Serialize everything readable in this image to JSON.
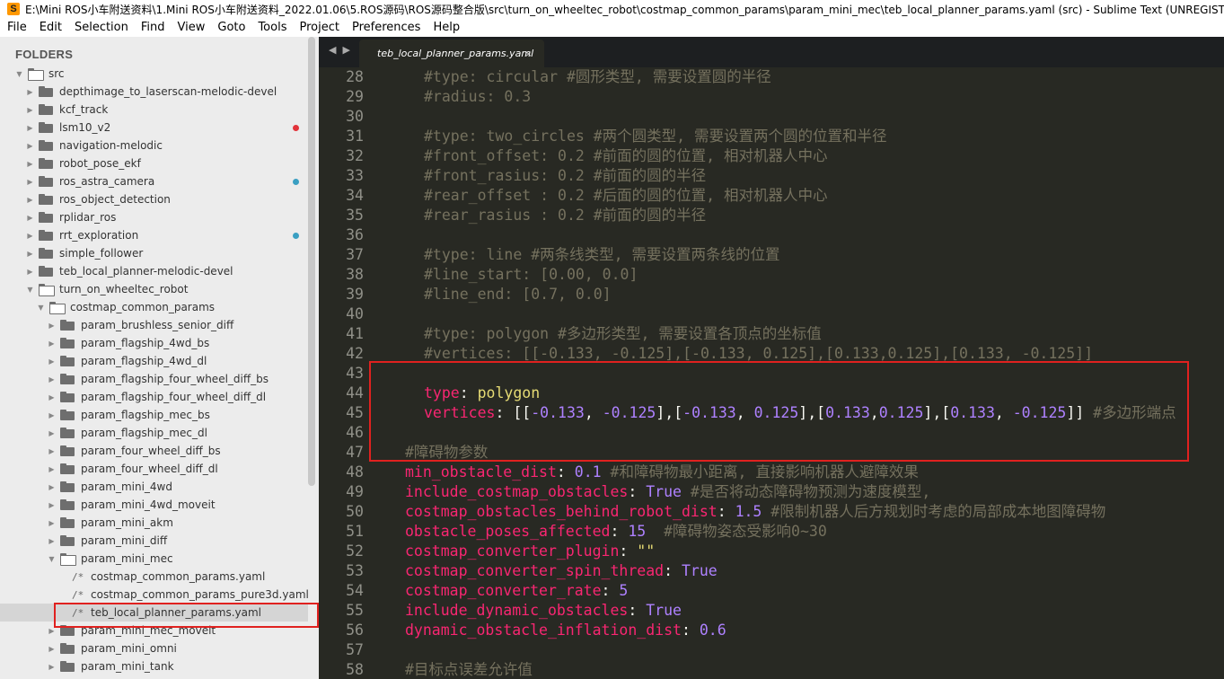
{
  "window": {
    "title": "E:\\Mini ROS小车附送资料\\1.Mini ROS小车附送资料_2022.01.06\\5.ROS源码\\ROS源码整合版\\src\\turn_on_wheeltec_robot\\costmap_common_params\\param_mini_mec\\teb_local_planner_params.yaml (src) - Sublime Text (UNREGISTERED)",
    "app_icon": "S"
  },
  "menu": [
    "File",
    "Edit",
    "Selection",
    "Find",
    "View",
    "Goto",
    "Tools",
    "Project",
    "Preferences",
    "Help"
  ],
  "sidebar": {
    "header": "FOLDERS",
    "items": [
      {
        "label": "src",
        "type": "folder",
        "open": true,
        "depth": 0
      },
      {
        "label": "depthimage_to_laserscan-melodic-devel",
        "type": "folder",
        "depth": 1
      },
      {
        "label": "kcf_track",
        "type": "folder",
        "depth": 1
      },
      {
        "label": "lsm10_v2",
        "type": "folder",
        "depth": 1,
        "status": "red"
      },
      {
        "label": "navigation-melodic",
        "type": "folder",
        "depth": 1
      },
      {
        "label": "robot_pose_ekf",
        "type": "folder",
        "depth": 1
      },
      {
        "label": "ros_astra_camera",
        "type": "folder",
        "depth": 1,
        "status": "teal"
      },
      {
        "label": "ros_object_detection",
        "type": "folder",
        "depth": 1
      },
      {
        "label": "rplidar_ros",
        "type": "folder",
        "depth": 1
      },
      {
        "label": "rrt_exploration",
        "type": "folder",
        "depth": 1,
        "status": "teal"
      },
      {
        "label": "simple_follower",
        "type": "folder",
        "depth": 1
      },
      {
        "label": "teb_local_planner-melodic-devel",
        "type": "folder",
        "depth": 1
      },
      {
        "label": "turn_on_wheeltec_robot",
        "type": "folder",
        "open": true,
        "depth": 1
      },
      {
        "label": "costmap_common_params",
        "type": "folder",
        "open": true,
        "depth": 2
      },
      {
        "label": "param_brushless_senior_diff",
        "type": "folder",
        "depth": 3
      },
      {
        "label": "param_flagship_4wd_bs",
        "type": "folder",
        "depth": 3
      },
      {
        "label": "param_flagship_4wd_dl",
        "type": "folder",
        "depth": 3
      },
      {
        "label": "param_flagship_four_wheel_diff_bs",
        "type": "folder",
        "depth": 3
      },
      {
        "label": "param_flagship_four_wheel_diff_dl",
        "type": "folder",
        "depth": 3
      },
      {
        "label": "param_flagship_mec_bs",
        "type": "folder",
        "depth": 3
      },
      {
        "label": "param_flagship_mec_dl",
        "type": "folder",
        "depth": 3
      },
      {
        "label": "param_four_wheel_diff_bs",
        "type": "folder",
        "depth": 3
      },
      {
        "label": "param_four_wheel_diff_dl",
        "type": "folder",
        "depth": 3
      },
      {
        "label": "param_mini_4wd",
        "type": "folder",
        "depth": 3
      },
      {
        "label": "param_mini_4wd_moveit",
        "type": "folder",
        "depth": 3
      },
      {
        "label": "param_mini_akm",
        "type": "folder",
        "depth": 3
      },
      {
        "label": "param_mini_diff",
        "type": "folder",
        "depth": 3
      },
      {
        "label": "param_mini_mec",
        "type": "folder",
        "open": true,
        "depth": 3
      },
      {
        "label": "costmap_common_params.yaml",
        "type": "file",
        "depth": 4
      },
      {
        "label": "costmap_common_params_pure3d.yaml",
        "type": "file",
        "depth": 4
      },
      {
        "label": "teb_local_planner_params.yaml",
        "type": "file",
        "depth": 4,
        "selected": true
      },
      {
        "label": "param_mini_mec_moveit",
        "type": "folder",
        "depth": 3
      },
      {
        "label": "param_mini_omni",
        "type": "folder",
        "depth": 3
      },
      {
        "label": "param_mini_tank",
        "type": "folder",
        "depth": 3
      }
    ]
  },
  "tabs": {
    "nav": "◀ ▶",
    "active": "teb_local_planner_params.yaml",
    "close": "×"
  },
  "editor": {
    "lines": [
      {
        "n": "28",
        "indent": 2,
        "parts": [
          {
            "t": "#type: circular #圆形类型, 需要设置圆的半径",
            "c": "cm"
          }
        ]
      },
      {
        "n": "29",
        "indent": 2,
        "parts": [
          {
            "t": "#radius: 0.3",
            "c": "cm"
          }
        ]
      },
      {
        "n": "30",
        "indent": 2,
        "parts": []
      },
      {
        "n": "31",
        "indent": 2,
        "parts": [
          {
            "t": "#type: two_circles #两个圆类型, 需要设置两个圆的位置和半径",
            "c": "cm"
          }
        ]
      },
      {
        "n": "32",
        "indent": 2,
        "parts": [
          {
            "t": "#front_offset: 0.2 #前面的圆的位置, 相对机器人中心",
            "c": "cm"
          }
        ]
      },
      {
        "n": "33",
        "indent": 2,
        "parts": [
          {
            "t": "#front_rasius: 0.2 #前面的圆的半径",
            "c": "cm"
          }
        ]
      },
      {
        "n": "34",
        "indent": 2,
        "parts": [
          {
            "t": "#rear_offset : 0.2 #后面的圆的位置, 相对机器人中心",
            "c": "cm"
          }
        ]
      },
      {
        "n": "35",
        "indent": 2,
        "parts": [
          {
            "t": "#rear_rasius : 0.2 #前面的圆的半径",
            "c": "cm"
          }
        ]
      },
      {
        "n": "36",
        "indent": 2,
        "parts": []
      },
      {
        "n": "37",
        "indent": 2,
        "parts": [
          {
            "t": "#type: line #两条线类型, 需要设置两条线的位置",
            "c": "cm"
          }
        ]
      },
      {
        "n": "38",
        "indent": 2,
        "parts": [
          {
            "t": "#line_start: [0.00, 0.0]",
            "c": "cm"
          }
        ]
      },
      {
        "n": "39",
        "indent": 2,
        "parts": [
          {
            "t": "#line_end: [0.7, 0.0]",
            "c": "cm"
          }
        ]
      },
      {
        "n": "40",
        "indent": 2,
        "parts": []
      },
      {
        "n": "41",
        "indent": 2,
        "parts": [
          {
            "t": "#type: polygon #多边形类型, 需要设置各顶点的坐标值",
            "c": "cm"
          }
        ]
      },
      {
        "n": "42",
        "indent": 2,
        "parts": [
          {
            "t": "#vertices: [[-0.133, -0.125],[-0.133, 0.125],[0.133,0.125],[0.133, -0.125]]",
            "c": "cm"
          }
        ]
      },
      {
        "n": "43",
        "indent": 2,
        "parts": []
      },
      {
        "n": "44",
        "indent": 2,
        "parts": [
          {
            "t": "type",
            "c": "k"
          },
          {
            "t": ": ",
            "c": "p"
          },
          {
            "t": "polygon",
            "c": "v"
          }
        ]
      },
      {
        "n": "45",
        "indent": 2,
        "parts": [
          {
            "t": "vertices",
            "c": "k"
          },
          {
            "t": ": [[",
            "c": "p"
          },
          {
            "t": "-0.133",
            "c": "n"
          },
          {
            "t": ", ",
            "c": "p"
          },
          {
            "t": "-0.125",
            "c": "n"
          },
          {
            "t": "],[",
            "c": "p"
          },
          {
            "t": "-0.133",
            "c": "n"
          },
          {
            "t": ", ",
            "c": "p"
          },
          {
            "t": "0.125",
            "c": "n"
          },
          {
            "t": "],[",
            "c": "p"
          },
          {
            "t": "0.133",
            "c": "n"
          },
          {
            "t": ",",
            "c": "p"
          },
          {
            "t": "0.125",
            "c": "n"
          },
          {
            "t": "],[",
            "c": "p"
          },
          {
            "t": "0.133",
            "c": "n"
          },
          {
            "t": ", ",
            "c": "p"
          },
          {
            "t": "-0.125",
            "c": "n"
          },
          {
            "t": "]] ",
            "c": "p"
          },
          {
            "t": "#多边形端点",
            "c": "cm"
          }
        ]
      },
      {
        "n": "46",
        "indent": 2,
        "parts": []
      },
      {
        "n": "47",
        "indent": 1,
        "parts": [
          {
            "t": "#障碍物参数",
            "c": "cm"
          }
        ]
      },
      {
        "n": "48",
        "indent": 1,
        "parts": [
          {
            "t": "min_obstacle_dist",
            "c": "k"
          },
          {
            "t": ": ",
            "c": "p"
          },
          {
            "t": "0.1",
            "c": "n"
          },
          {
            "t": " #和障碍物最小距离, 直接影响机器人避障效果",
            "c": "cm"
          }
        ]
      },
      {
        "n": "49",
        "indent": 1,
        "parts": [
          {
            "t": "include_costmap_obstacles",
            "c": "k"
          },
          {
            "t": ": ",
            "c": "p"
          },
          {
            "t": "True",
            "c": "n"
          },
          {
            "t": " #是否将动态障碍物预测为速度模型,",
            "c": "cm"
          }
        ]
      },
      {
        "n": "50",
        "indent": 1,
        "parts": [
          {
            "t": "costmap_obstacles_behind_robot_dist",
            "c": "k"
          },
          {
            "t": ": ",
            "c": "p"
          },
          {
            "t": "1.5",
            "c": "n"
          },
          {
            "t": " #限制机器人后方规划时考虑的局部成本地图障碍物",
            "c": "cm"
          }
        ]
      },
      {
        "n": "51",
        "indent": 1,
        "parts": [
          {
            "t": "obstacle_poses_affected",
            "c": "k"
          },
          {
            "t": ": ",
            "c": "p"
          },
          {
            "t": "15",
            "c": "n"
          },
          {
            "t": "  #障碍物姿态受影响0~30",
            "c": "cm"
          }
        ]
      },
      {
        "n": "52",
        "indent": 1,
        "parts": [
          {
            "t": "costmap_converter_plugin",
            "c": "k"
          },
          {
            "t": ": ",
            "c": "p"
          },
          {
            "t": "\"\"",
            "c": "v"
          }
        ]
      },
      {
        "n": "53",
        "indent": 1,
        "parts": [
          {
            "t": "costmap_converter_spin_thread",
            "c": "k"
          },
          {
            "t": ": ",
            "c": "p"
          },
          {
            "t": "True",
            "c": "n"
          }
        ]
      },
      {
        "n": "54",
        "indent": 1,
        "parts": [
          {
            "t": "costmap_converter_rate",
            "c": "k"
          },
          {
            "t": ": ",
            "c": "p"
          },
          {
            "t": "5",
            "c": "n"
          }
        ]
      },
      {
        "n": "55",
        "indent": 1,
        "parts": [
          {
            "t": "include_dynamic_obstacles",
            "c": "k"
          },
          {
            "t": ": ",
            "c": "p"
          },
          {
            "t": "True",
            "c": "n"
          }
        ]
      },
      {
        "n": "56",
        "indent": 1,
        "parts": [
          {
            "t": "dynamic_obstacle_inflation_dist",
            "c": "k"
          },
          {
            "t": ": ",
            "c": "p"
          },
          {
            "t": "0.6",
            "c": "n"
          }
        ]
      },
      {
        "n": "57",
        "indent": 1,
        "parts": []
      },
      {
        "n": "58",
        "indent": 1,
        "parts": [
          {
            "t": "#目标点误差允许值",
            "c": "cm"
          }
        ]
      }
    ]
  },
  "colors": {
    "editor_bg": "#282923",
    "annotation_red": "#e0211f",
    "keyword": "#f92672",
    "string": "#e6db74",
    "number": "#ae81ff",
    "comment": "#75715e"
  }
}
